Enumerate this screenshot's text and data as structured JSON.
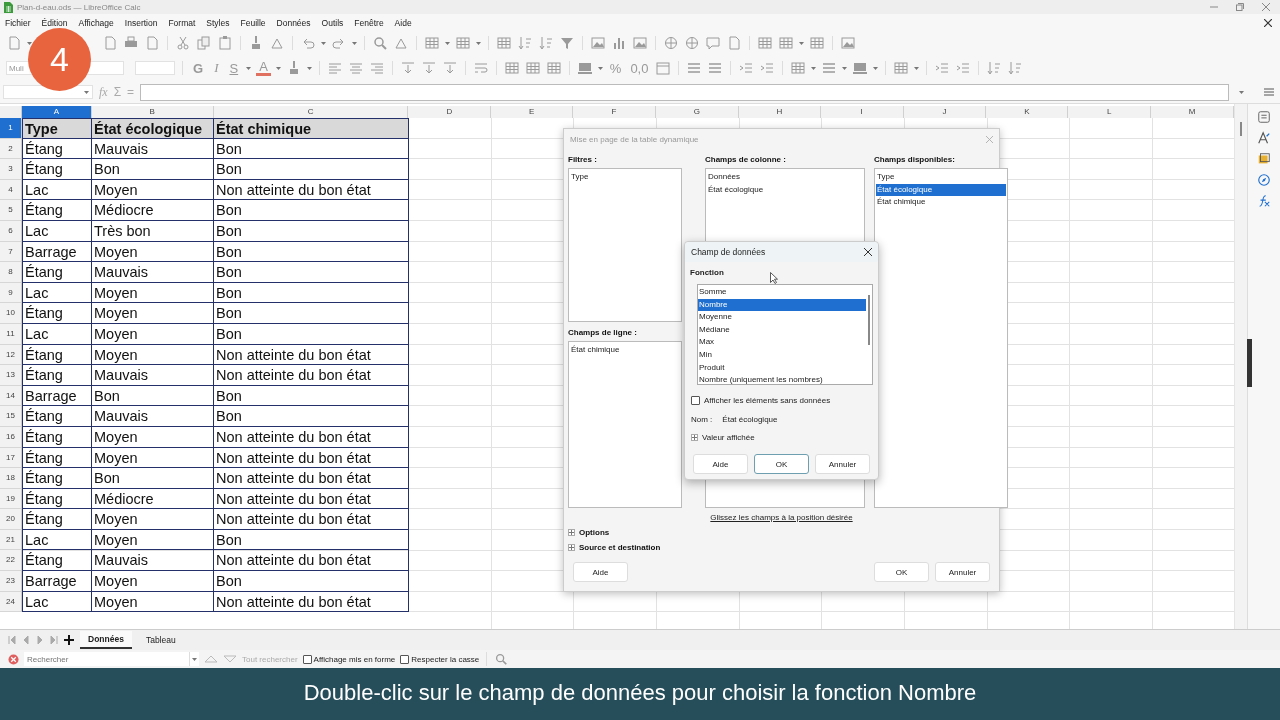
{
  "window": {
    "title": "Plan-d-eau.ods — LibreOffice Calc"
  },
  "menu": [
    "Fichier",
    "Édition",
    "Affichage",
    "Insertion",
    "Format",
    "Styles",
    "Feuille",
    "Données",
    "Outils",
    "Fenêtre",
    "Aide"
  ],
  "step_badge": "4",
  "format_toolbar": {
    "font_name": "Muli",
    "letters": [
      {
        "text": "G",
        "kind": "bold"
      },
      {
        "text": "I",
        "kind": "italic"
      },
      {
        "text": "S",
        "kind": "underline"
      },
      {
        "text": "A",
        "kind": "font-color"
      }
    ],
    "number_buttons": [
      "%",
      "0,0"
    ]
  },
  "formula_bar": {
    "symbols": [
      "fx",
      "Σ",
      "="
    ]
  },
  "sheet": {
    "columns": [
      {
        "label": "A",
        "selected": true
      },
      {
        "label": "B",
        "selected": false
      },
      {
        "label": "C",
        "selected": false
      },
      {
        "label": "D",
        "selected": false
      },
      {
        "label": "E",
        "selected": false
      },
      {
        "label": "F",
        "selected": false
      },
      {
        "label": "G",
        "selected": false
      },
      {
        "label": "H",
        "selected": false
      },
      {
        "label": "I",
        "selected": false
      },
      {
        "label": "J",
        "selected": false
      },
      {
        "label": "K",
        "selected": false
      },
      {
        "label": "L",
        "selected": false
      },
      {
        "label": "M",
        "selected": false
      }
    ],
    "rows": [
      {
        "number": "1",
        "selected": true,
        "kind": "header",
        "cells": [
          "Type",
          "État écologique",
          "État chimique"
        ]
      },
      {
        "number": "2",
        "selected": false,
        "kind": "data",
        "cells": [
          "Étang",
          "Mauvais",
          "Bon"
        ]
      },
      {
        "number": "3",
        "selected": false,
        "kind": "data",
        "cells": [
          "Étang",
          "Bon",
          "Bon"
        ]
      },
      {
        "number": "4",
        "selected": false,
        "kind": "data",
        "cells": [
          "Lac",
          "Moyen",
          "Non atteinte du bon état"
        ]
      },
      {
        "number": "5",
        "selected": false,
        "kind": "data",
        "cells": [
          "Étang",
          "Médiocre",
          "Bon"
        ]
      },
      {
        "number": "6",
        "selected": false,
        "kind": "data",
        "cells": [
          "Lac",
          "Très bon",
          "Bon"
        ]
      },
      {
        "number": "7",
        "selected": false,
        "kind": "data",
        "cells": [
          "Barrage",
          "Moyen",
          "Bon"
        ]
      },
      {
        "number": "8",
        "selected": false,
        "kind": "data",
        "cells": [
          "Étang",
          "Mauvais",
          "Bon"
        ]
      },
      {
        "number": "9",
        "selected": false,
        "kind": "data",
        "cells": [
          "Lac",
          "Moyen",
          "Bon"
        ]
      },
      {
        "number": "10",
        "selected": false,
        "kind": "data",
        "cells": [
          "Étang",
          "Moyen",
          "Bon"
        ]
      },
      {
        "number": "11",
        "selected": false,
        "kind": "data",
        "cells": [
          "Lac",
          "Moyen",
          "Bon"
        ]
      },
      {
        "number": "12",
        "selected": false,
        "kind": "data",
        "cells": [
          "Étang",
          "Moyen",
          "Non atteinte du bon état"
        ]
      },
      {
        "number": "13",
        "selected": false,
        "kind": "data",
        "cells": [
          "Étang",
          "Mauvais",
          "Non atteinte du bon état"
        ]
      },
      {
        "number": "14",
        "selected": false,
        "kind": "data",
        "cells": [
          "Barrage",
          "Bon",
          "Bon"
        ]
      },
      {
        "number": "15",
        "selected": false,
        "kind": "data",
        "cells": [
          "Étang",
          "Mauvais",
          "Bon"
        ]
      },
      {
        "number": "16",
        "selected": false,
        "kind": "data",
        "cells": [
          "Étang",
          "Moyen",
          "Non atteinte du bon état"
        ]
      },
      {
        "number": "17",
        "selected": false,
        "kind": "data",
        "cells": [
          "Étang",
          "Moyen",
          "Non atteinte du bon état"
        ]
      },
      {
        "number": "18",
        "selected": false,
        "kind": "data",
        "cells": [
          "Étang",
          "Bon",
          "Non atteinte du bon état"
        ]
      },
      {
        "number": "19",
        "selected": false,
        "kind": "data",
        "cells": [
          "Étang",
          "Médiocre",
          "Non atteinte du bon état"
        ]
      },
      {
        "number": "20",
        "selected": false,
        "kind": "data",
        "cells": [
          "Étang",
          "Moyen",
          "Non atteinte du bon état"
        ]
      },
      {
        "number": "21",
        "selected": false,
        "kind": "data",
        "cells": [
          "Lac",
          "Moyen",
          "Bon"
        ]
      },
      {
        "number": "22",
        "selected": false,
        "kind": "data",
        "cells": [
          "Étang",
          "Mauvais",
          "Non atteinte du bon état"
        ]
      },
      {
        "number": "23",
        "selected": false,
        "kind": "data",
        "cells": [
          "Barrage",
          "Moyen",
          "Bon"
        ]
      },
      {
        "number": "24",
        "selected": false,
        "kind": "data",
        "cells": [
          "Lac",
          "Moyen",
          "Non atteinte du bon état"
        ]
      }
    ]
  },
  "pivot_dialog": {
    "title": "Mise en page de la table dynamique",
    "filters": {
      "label": "Filtres :",
      "items": [
        "Type"
      ]
    },
    "column_fields": {
      "label": "Champs de colonne :",
      "items": [
        "Données",
        "État écologique"
      ]
    },
    "row_fields": {
      "label": "Champs de ligne :",
      "items": [
        "État chimique"
      ]
    },
    "available_fields": {
      "label": "Champs disponibles:",
      "items": [
        {
          "label": "Type",
          "selected": false
        },
        {
          "label": "État écologique",
          "selected": true
        },
        {
          "label": "État chimique",
          "selected": false
        }
      ]
    },
    "hint_link": "Glissez les champs à la position désirée",
    "expanders": [
      {
        "label": "Options",
        "expanded": false
      },
      {
        "label": "Source et destination",
        "expanded": false
      }
    ],
    "buttons": [
      "Aide",
      "OK",
      "Annuler"
    ]
  },
  "data_field_dialog": {
    "title": "Champ de données",
    "function_label": "Fonction",
    "functions": [
      {
        "label": "Somme",
        "selected": false
      },
      {
        "label": "Nombre",
        "selected": true
      },
      {
        "label": "Moyenne",
        "selected": false
      },
      {
        "label": "Médiane",
        "selected": false
      },
      {
        "label": "Max",
        "selected": false
      },
      {
        "label": "Min",
        "selected": false
      },
      {
        "label": "Produit",
        "selected": false
      },
      {
        "label": "Nombre (uniquement les nombres)",
        "selected": false
      }
    ],
    "show_empty": {
      "label": "Afficher les éléments sans données",
      "checked": false
    },
    "name_label": "Nom :",
    "name_value": "État écologique",
    "displayed_value": {
      "label": "Valeur affichée",
      "expanded": false
    },
    "buttons": [
      {
        "label": "Aide",
        "default": false
      },
      {
        "label": "OK",
        "default": true
      },
      {
        "label": "Annuler",
        "default": false
      }
    ]
  },
  "sheet_tabs": [
    {
      "label": "Données",
      "selected": true
    },
    {
      "label": "Tableau",
      "selected": false
    }
  ],
  "find_bar": {
    "placeholder": "Rechercher",
    "find_all": "Tout rechercher",
    "options": [
      {
        "label": "Affichage mis en forme",
        "checked": false
      },
      {
        "label": "Respecter la casse",
        "checked": false
      }
    ]
  },
  "caption": "Double-clic sur le champ de données pour choisir la fonction Nombre"
}
